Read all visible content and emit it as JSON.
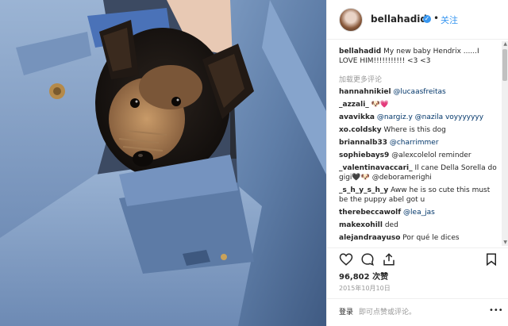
{
  "photo": {
    "subject": "yorkie-puppy-in-denim"
  },
  "header": {
    "username": "bellahadid",
    "dot": "•",
    "follow": "关注"
  },
  "caption": {
    "username": "bellahadid",
    "text": "My new baby Hendrix ......I LOVE HIM!!!!!!!!!!! <3 <3"
  },
  "load_more": "加载更多评论",
  "comments": [
    {
      "user": "hannahnikiel",
      "text": "@lucaasfreitas"
    },
    {
      "user": "_azzali_",
      "text": "🐶💗"
    },
    {
      "user": "avavikka",
      "text": "@nargiz.y @nazila voyyyyyyy"
    },
    {
      "user": "xo.coldsky",
      "text": "Where is this dog"
    },
    {
      "user": "briannalb33",
      "text": "@charrimmer"
    },
    {
      "user": "sophiebays9",
      "text": "@alexcolelol reminder"
    },
    {
      "user": "_valentinavaccari_",
      "text": "Il cane Della Sorella do gigi🖤🐶 @deboramerighi"
    },
    {
      "user": "_s_h_y_s_h_y",
      "text": "Aww he is so cute this must be the puppy abel got u"
    },
    {
      "user": "therebeccawolf",
      "text": "@lea_jas"
    },
    {
      "user": "makexohill",
      "text": "ded"
    },
    {
      "user": "alejandraayuso",
      "text": "Por qué le dices"
    }
  ],
  "likes": {
    "count": "96,802",
    "label": "次赞"
  },
  "date": "2015年10月10日",
  "footer": {
    "login": "登录",
    "hint": "即可点赞或评论。",
    "more": "•••"
  },
  "icons": [
    "heart-icon",
    "comment-icon",
    "share-icon",
    "bookmark-icon",
    "verified-badge-icon"
  ],
  "colors": {
    "link": "#3897f0",
    "mention": "#003569",
    "text": "#262626",
    "muted": "#999999"
  }
}
